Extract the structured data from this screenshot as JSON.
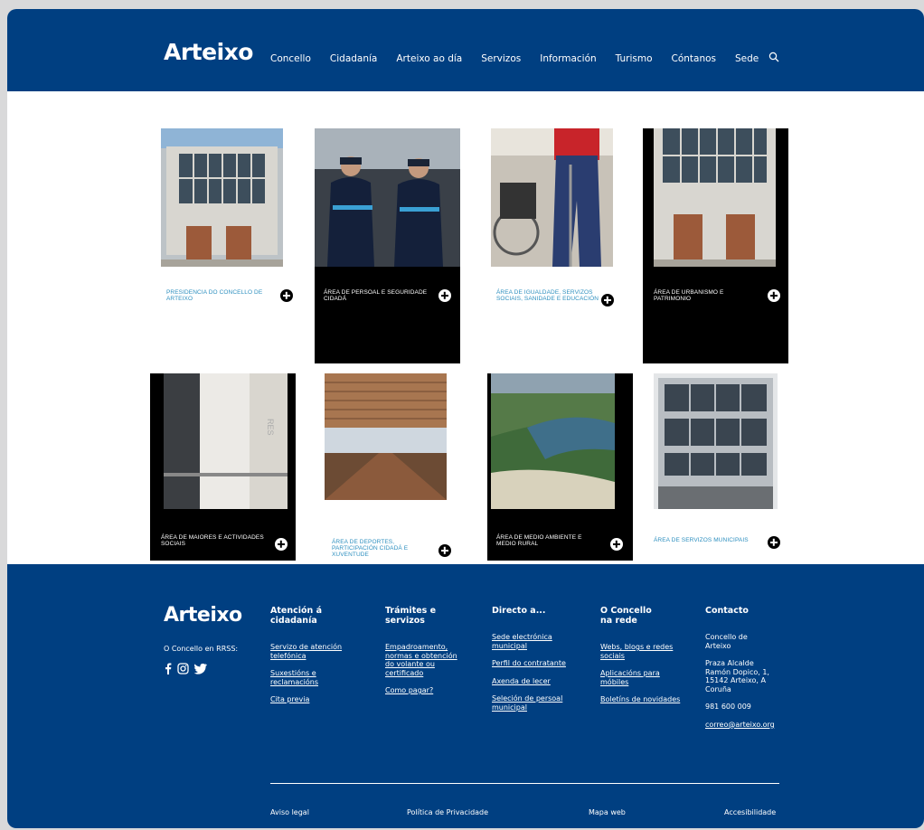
{
  "header": {
    "logo": "Arteixo",
    "nav": [
      "Concello",
      "Cidadanía",
      "Arteixo ao día",
      "Servizos",
      "Información",
      "Turismo",
      "Cóntanos",
      "Sede"
    ],
    "search_icon": "search-icon"
  },
  "cards": [
    {
      "label": "PRESIDENCIA DO CONCELLO DE ARTEIXO",
      "theme": "white",
      "image": "town-hall-photo"
    },
    {
      "label": "ÁREA DE PERSOAL E SEGURIDADE CIDADÁ",
      "theme": "black",
      "image": "police-officers-photo"
    },
    {
      "label": "ÁREA DE IGUALDADE, SERVIZOS SOCIAIS, SANIDADE E EDUCACIÓN",
      "theme": "white",
      "image": "wheelchair-photo"
    },
    {
      "label": "ÁREA DE URBANISMO E PATRIMONIO",
      "theme": "black",
      "image": "town-hall-doors-photo"
    },
    {
      "label": "ÁREA DE MAIORES E ACTIVIDADES SOCIAIS",
      "theme": "black",
      "image": "modern-building-photo"
    },
    {
      "label": "ÁREA DE DEPORTES, PARTICIPACIÓN CIDADÁ E XUVENTUDE",
      "theme": "white",
      "image": "sports-hall-photo"
    },
    {
      "label": "ÁREA DE MEDIO AMBIENTE E MEDIO RURAL",
      "theme": "black",
      "image": "coast-landscape-photo"
    },
    {
      "label": "ÁREA DE SERVIZOS MUNICIPAIS",
      "theme": "white",
      "image": "office-building-photo"
    }
  ],
  "footer": {
    "logo": "Arteixo",
    "rrss_label": "O Concello en RRSS:",
    "social_icons": [
      "facebook-icon",
      "instagram-icon",
      "twitter-icon"
    ],
    "col1": {
      "title": "Atención á cidadanía",
      "links": [
        "Servizo de atención telefónica",
        "Suxestións e reclamacións",
        "Cita previa"
      ]
    },
    "col2": {
      "title": "Trámites e servizos",
      "links": [
        "Empadroamento, normas e obtención do volante ou certificado",
        "Como pagar?"
      ]
    },
    "col3": {
      "title": "Directo a...",
      "links": [
        "Sede electrónica municipal",
        "Perfil do contratante",
        "Axenda de lecer",
        "Seleción de persoal municipal"
      ]
    },
    "col4": {
      "title": "O Concello na rede",
      "links": [
        "Webs, blogs e redes sociais",
        "Aplicacións para móbiles",
        "Boletíns de novidades"
      ]
    },
    "col5": {
      "title": "Contacto",
      "name": "Concello de Arteixo",
      "address": "Praza Alcalde Ramón Dopico, 1, 15142 Arteixo, A Coruña",
      "phone": "981 600 009",
      "email": "correo@arteixo.org"
    },
    "legal": [
      "Aviso legal",
      "Política de Privacidade",
      "Mapa web",
      "Accesibilidade"
    ]
  },
  "colors": {
    "brand": "#003f81",
    "accent": "#2d8fbf"
  }
}
